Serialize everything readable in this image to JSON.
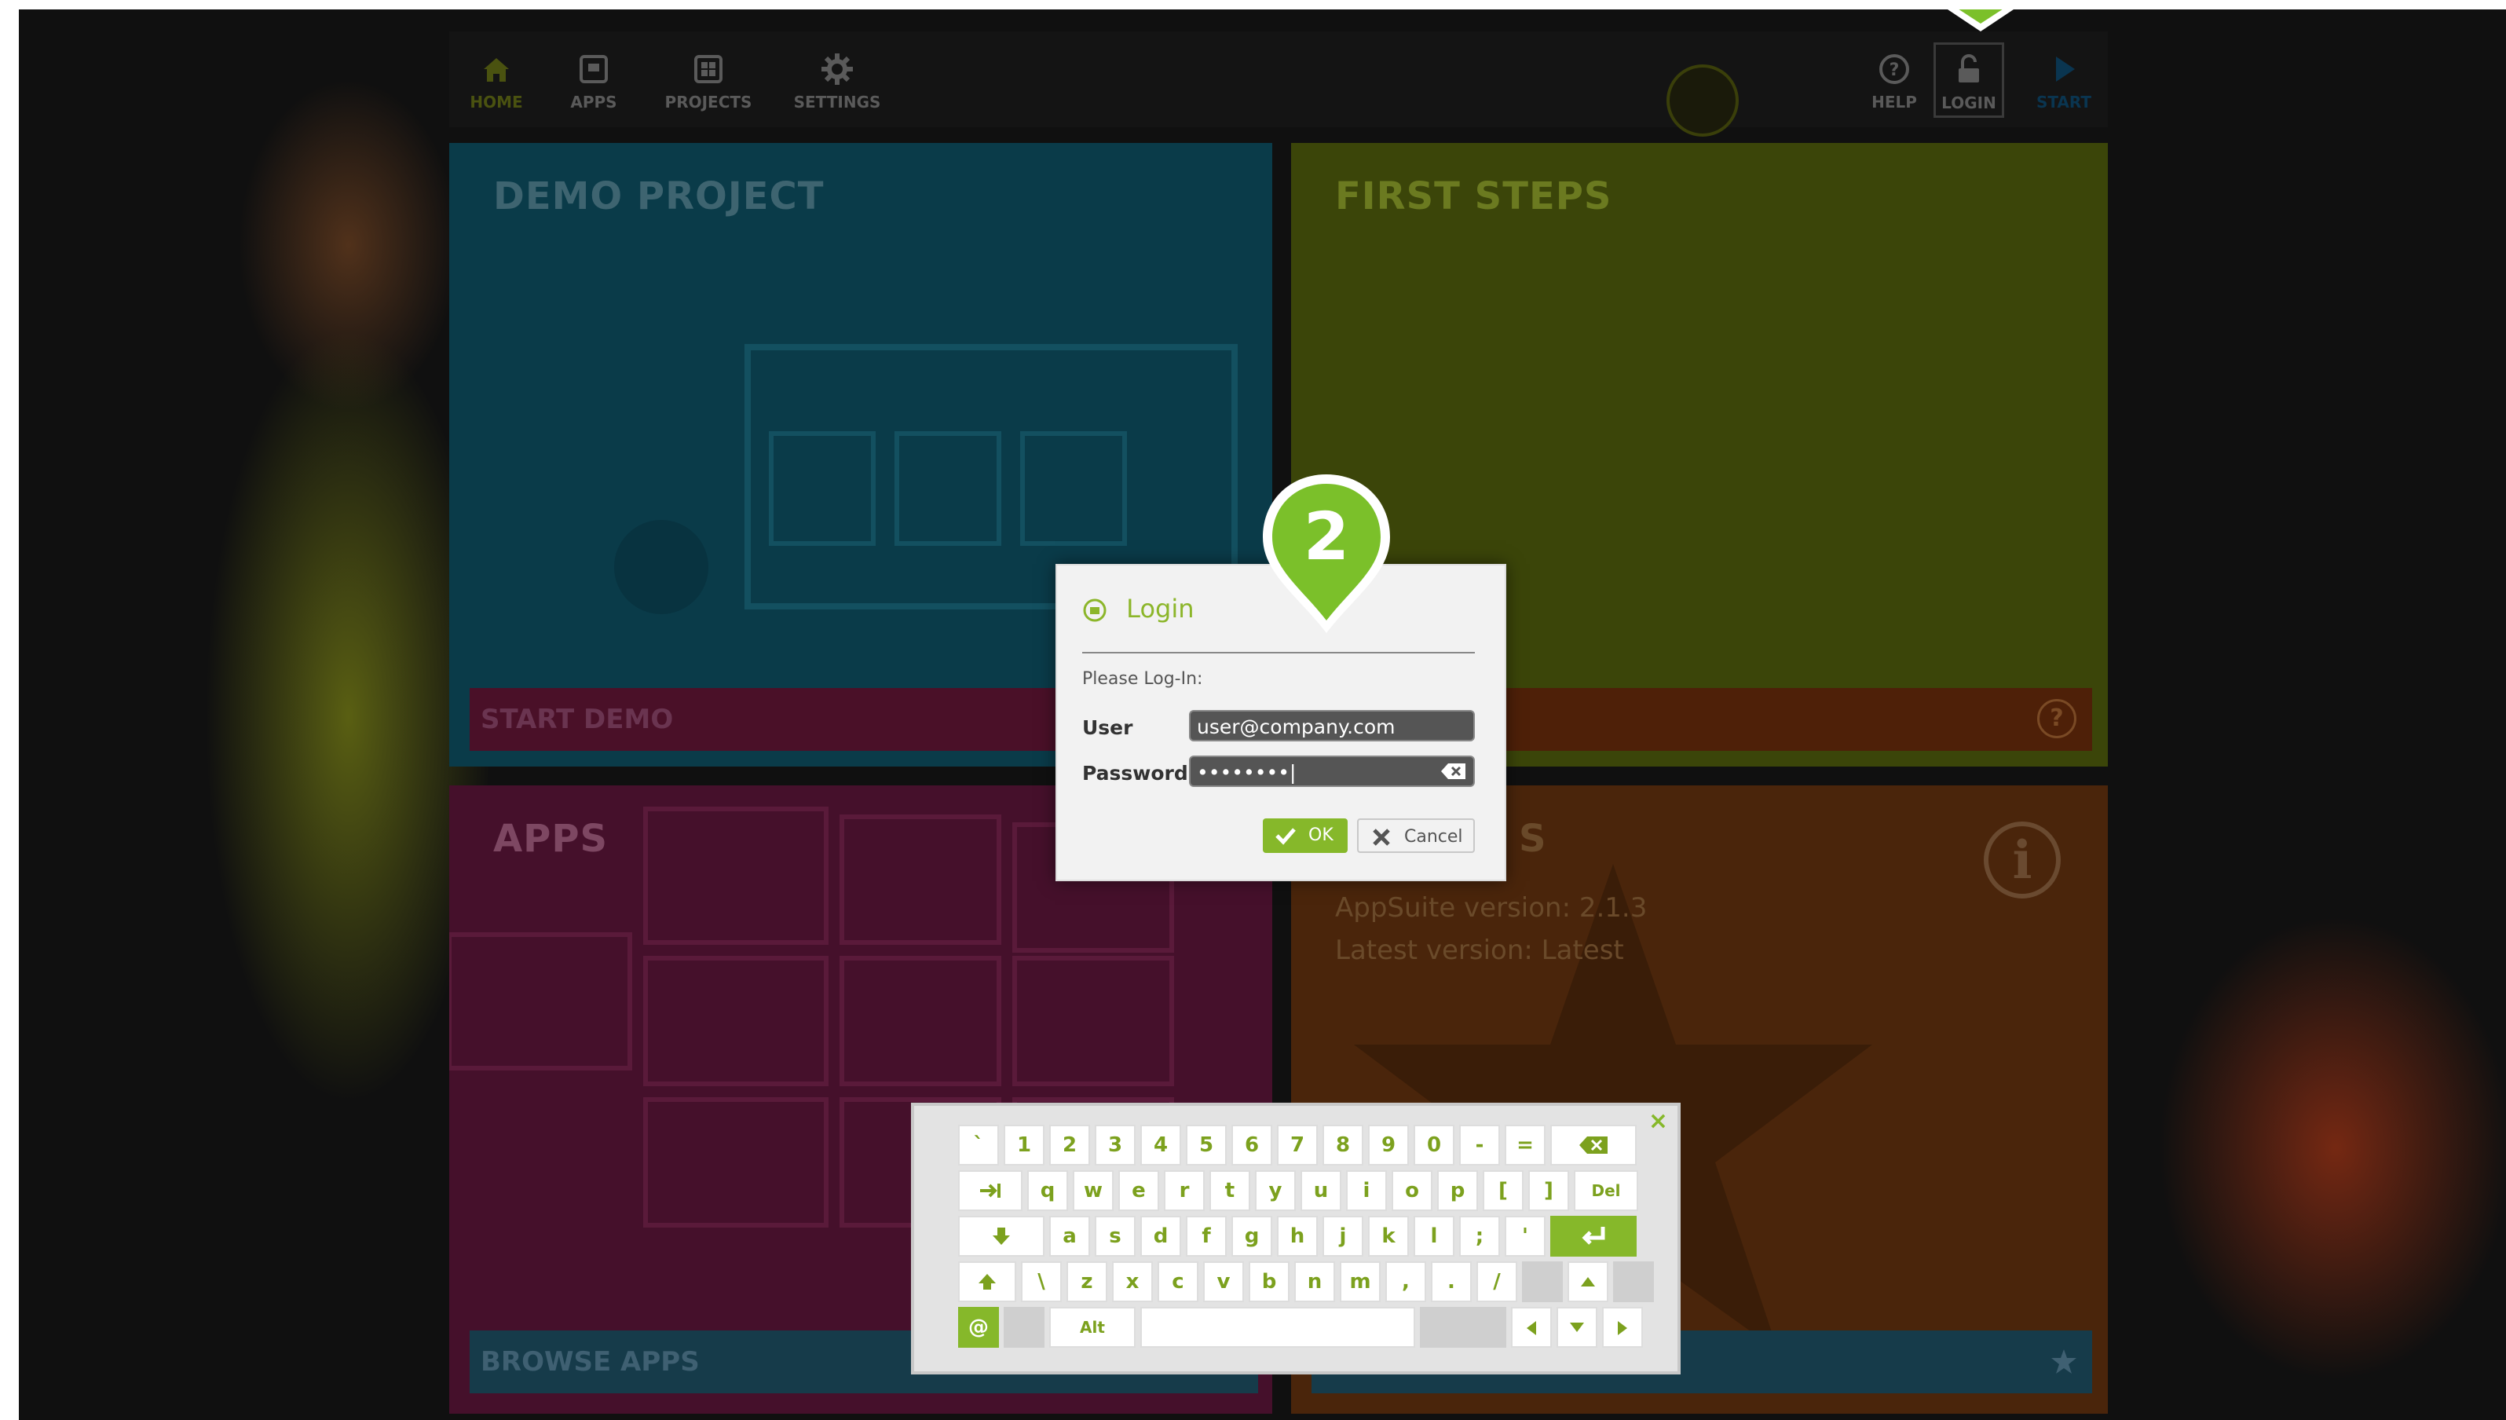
{
  "nav": {
    "home": "HOME",
    "apps": "APPS",
    "projects": "PROJECTS",
    "settings": "SETTINGS",
    "help": "HELP",
    "login": "LOGIN",
    "start": "START"
  },
  "tiles": {
    "demo": {
      "title": "DEMO PROJECT",
      "action": "START DEMO"
    },
    "steps": {
      "title": "FIRST STEPS",
      "help_glyph": "?"
    },
    "apps": {
      "title": "APPS",
      "action": "BROWSE APPS"
    },
    "info": {
      "title_fragment": "S",
      "version": "AppSuite version: 2.1.3",
      "latest": "Latest version: Latest",
      "info_glyph": "i"
    }
  },
  "dialog": {
    "title": "Login",
    "hint": "Please Log-In:",
    "user_label": "User",
    "user_value": "user@company.com",
    "password_label": "Password",
    "password_value": "••••••••|",
    "ok_label": "OK",
    "cancel_label": "Cancel"
  },
  "marker": {
    "number": "2"
  },
  "keyboard": {
    "close_glyph": "×",
    "row1": [
      "`",
      "1",
      "2",
      "3",
      "4",
      "5",
      "6",
      "7",
      "8",
      "9",
      "0",
      "-",
      "="
    ],
    "row2": [
      "q",
      "w",
      "e",
      "r",
      "t",
      "y",
      "u",
      "i",
      "o",
      "p",
      "[",
      "]"
    ],
    "row2_del": "Del",
    "row3": [
      "a",
      "s",
      "d",
      "f",
      "g",
      "h",
      "j",
      "k",
      "l",
      ";",
      "'"
    ],
    "row4": [
      "\\",
      "z",
      "x",
      "c",
      "v",
      "b",
      "n",
      "m",
      ",",
      ".",
      "/"
    ],
    "at_key": "@",
    "alt_key": "Alt"
  },
  "colors": {
    "accent": "#86b82a",
    "demo_tile": "#0a3b49",
    "steps_tile": "#3b4509",
    "apps_tile": "#45102b",
    "info_tile": "#4a250b"
  }
}
